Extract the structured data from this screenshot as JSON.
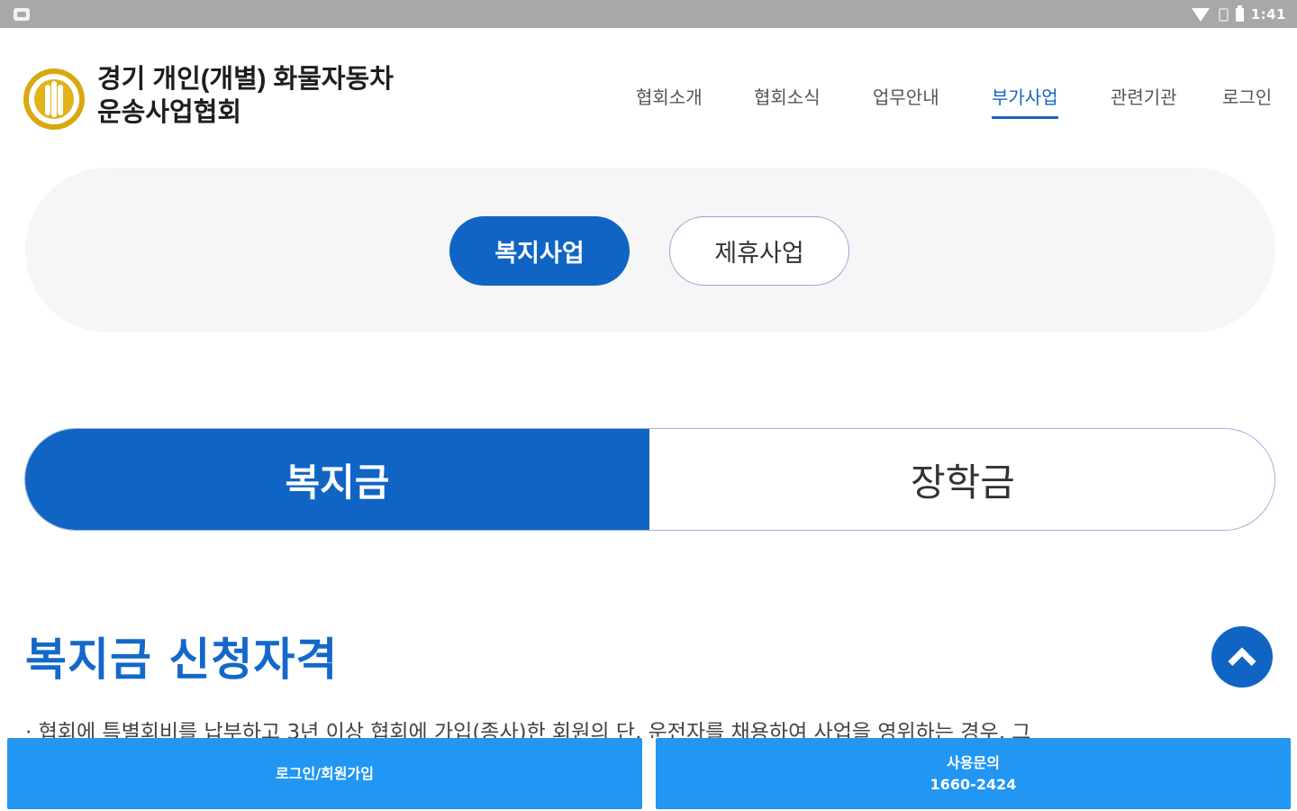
{
  "status_bar": {
    "time": "1:41",
    "icons": [
      "notification-icon",
      "wifi-icon",
      "sim-icon",
      "battery-icon"
    ]
  },
  "header": {
    "org_name": "경기 개인(개별) 화물자동차\n운송사업협회",
    "logo_icon": "association-emblem-icon",
    "nav": [
      {
        "label": "협회소개",
        "active": false
      },
      {
        "label": "협회소식",
        "active": false
      },
      {
        "label": "업무안내",
        "active": false
      },
      {
        "label": "부가사업",
        "active": true
      },
      {
        "label": "관련기관",
        "active": false
      },
      {
        "label": "로그인",
        "active": false
      }
    ]
  },
  "category_tabs": [
    {
      "label": "복지사업",
      "active": true
    },
    {
      "label": "제휴사업",
      "active": false
    }
  ],
  "sub_tabs": [
    {
      "label": "복지금",
      "active": true
    },
    {
      "label": "장학금",
      "active": false
    }
  ],
  "section": {
    "title": "복지금 신청자격",
    "text": "· 협회에 특별회비를 납부하고 3년 이상 협회에 가입(종사)한 회원의 단, 운전자를 채용하여 사업을 영위하는 경우, 그"
  },
  "scroll_top_icon": "chevron-up-icon",
  "bottom_bar": {
    "login_label": "로그인/회원가입",
    "inquiry_label": "사용문의",
    "inquiry_phone": "1660-2424"
  },
  "colors": {
    "primary": "#1065c4",
    "bottom_bar": "#2196f3",
    "status_bar": "#a8a8a8",
    "logo_gold": "#d9a80e"
  }
}
